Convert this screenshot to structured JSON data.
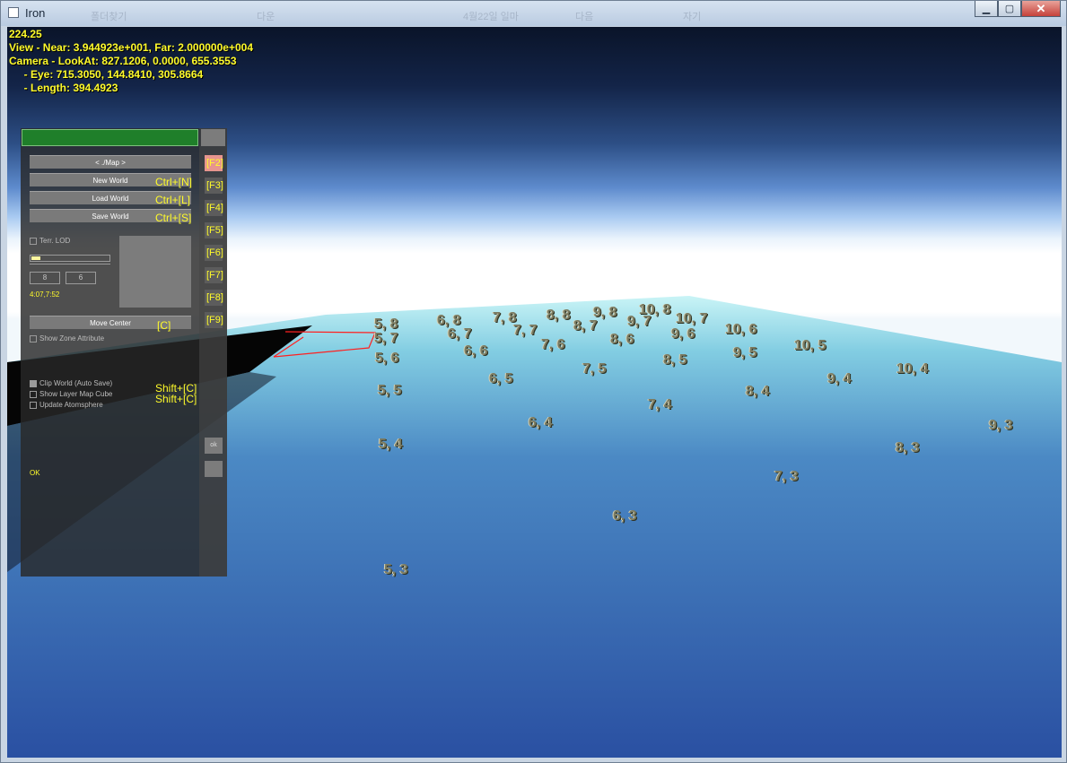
{
  "window": {
    "title": "Iron",
    "ghost_texts": [
      "폴더찾기",
      "다운",
      "4월22일 일마",
      "다음",
      "자기"
    ],
    "buttons": {
      "minimize": "▁",
      "maximize": "▢",
      "close": "✕"
    }
  },
  "hud": {
    "fps": "224.25",
    "view": "View - Near: 3.944923e+001, Far: 2.000000e+004",
    "camera": "Camera - LookAt: 827.1206, 0.0000, 655.3553",
    "eye": "     - Eye: 715.3050, 144.8410, 305.8664",
    "length": "     - Length: 394.4923"
  },
  "panel": {
    "map_button": "< ./Map >",
    "new_world": "New World",
    "load_world": "Load World",
    "save_world": "Save World",
    "shortcut_new": "Ctrl+[N]",
    "shortcut_load": "Ctrl+[L]",
    "shortcut_save": "Ctrl+[S]",
    "terr_lod": "Terr. LOD",
    "lod_level": 0.12,
    "num_a": "8",
    "num_b": "6",
    "coords": "4:07,7:52",
    "move_center": "Move Center",
    "shortcut_c": "[C]",
    "show_zone_attr": "Show Zone Attribute",
    "clip_world": "Clip World (Auto Save)",
    "show_layer_cube": "Show Layer Map Cube",
    "update_atmosphere": "Update Atomsphere",
    "shortcut_shift_c1": "Shift+[C]",
    "shortcut_shift_c2": "Shift+[C]",
    "status": "OK",
    "fkeys": [
      "[F2]",
      "[F3]",
      "[F4]",
      "[F5]",
      "[F6]",
      "[F7]",
      "[F8]",
      "[F9]"
    ],
    "small_btn": "ok"
  },
  "grid_labels": [
    "5, 8",
    "6, 8",
    "7, 8",
    "8, 8",
    "9, 8",
    "10, 8",
    "5, 7",
    "6, 7",
    "7, 7",
    "8, 7",
    "9, 7",
    "10, 7",
    "5, 6",
    "6, 6",
    "7, 6",
    "8, 6",
    "9, 6",
    "10, 6",
    "5, 5",
    "6, 5",
    "7, 5",
    "8, 5",
    "9, 5",
    "10, 5",
    "5, 4",
    "6, 4",
    "7, 4",
    "8, 4",
    "9, 4",
    "10, 4",
    "5, 3",
    "6, 3",
    "7, 3",
    "8, 3",
    "9, 3"
  ]
}
